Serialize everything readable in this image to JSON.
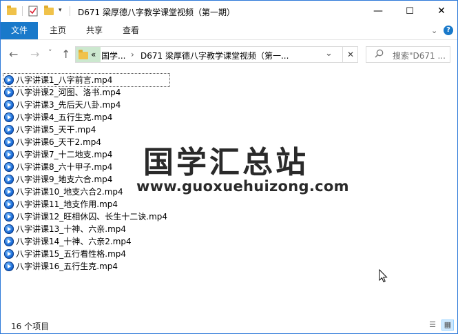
{
  "window": {
    "title": "D671 梁厚德八字教学课堂视频（第一期）",
    "minimize": "—",
    "maximize": "☐",
    "close": "✕"
  },
  "ribbon": {
    "file": "文件",
    "home": "主页",
    "share": "共享",
    "view": "查看",
    "help": "?"
  },
  "nav": {
    "back": "←",
    "forward": "→",
    "recent": "˅",
    "up": "↑",
    "breadcrumb_overflow": "«",
    "breadcrumb_1": "国学...",
    "breadcrumb_sep": "›",
    "breadcrumb_2": "D671 梁厚德八字教学课堂视频（第一...",
    "search_placeholder": "搜索\"D671 ...",
    "clear": "✕"
  },
  "files": [
    "八字讲课1_八字前言.mp4",
    "八字讲课2_河图、洛书.mp4",
    "八字讲课3_先后天八卦.mp4",
    "八字讲课4_五行生克.mp4",
    "八字讲课5_天干.mp4",
    "八字讲课6_天干2.mp4",
    "八字讲课7_十二地支.mp4",
    "八字讲课8_六十甲子.mp4",
    "八字讲课9_地支六合.mp4",
    "八字讲课10_地支六合2.mp4",
    "八字讲课11_地支作用.mp4",
    "八字讲课12_旺相休囚、长生十二诀.mp4",
    "八字讲课13_十神、六亲.mp4",
    "八字讲课14_十神、六亲2.mp4",
    "八字讲课15_五行看性格.mp4",
    "八字讲课16_五行生克.mp4"
  ],
  "watermark": {
    "title": "国学汇总站",
    "url": "www.guoxuehuizong.com"
  },
  "status": {
    "count": "16 个项目"
  },
  "colors": {
    "accent": "#1979ca",
    "address_highlight": "#cce8cf"
  }
}
